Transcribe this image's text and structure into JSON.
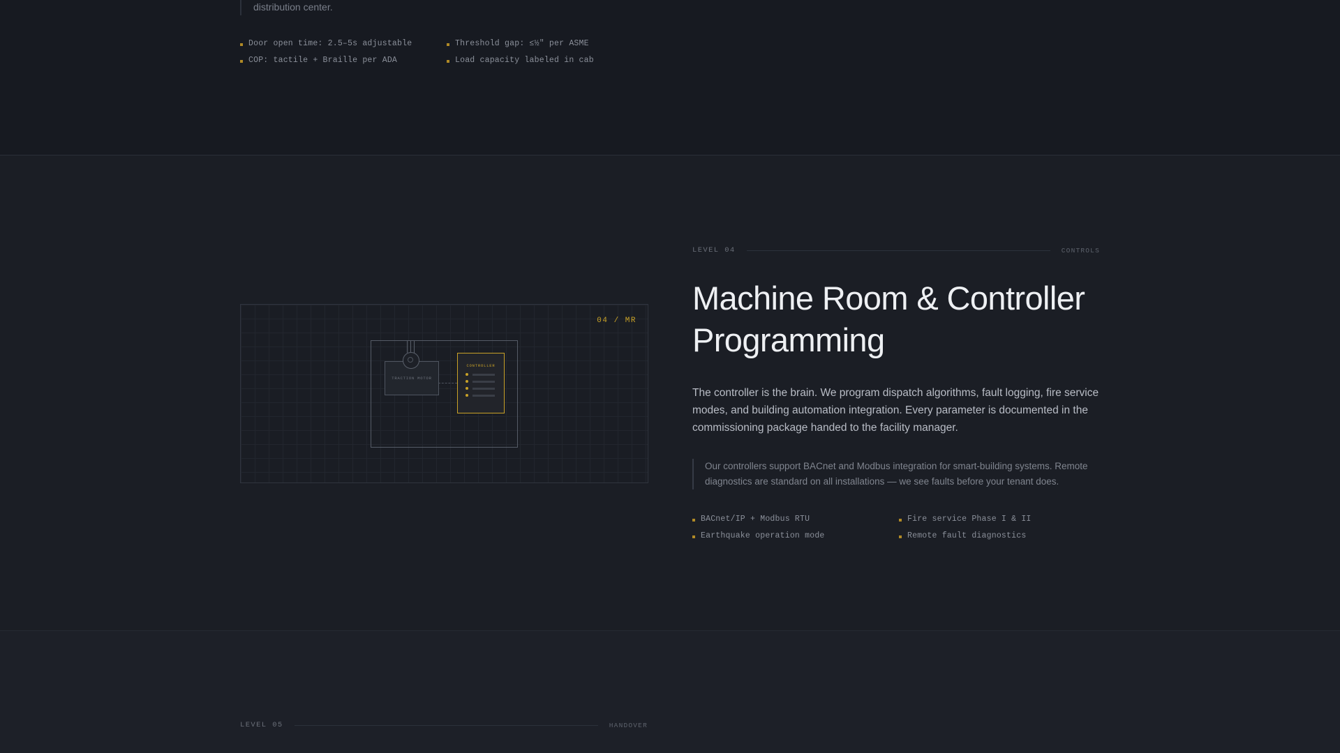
{
  "prev_section": {
    "quote_tail": "distribution center.",
    "features": [
      "Door open time: 2.5–5s adjustable",
      "Threshold gap: ≤½\" per ASME",
      "COP: tactile + Braille per ADA",
      "Load capacity labeled in cab"
    ]
  },
  "section4": {
    "level": "LEVEL 04",
    "tag": "CONTROLS",
    "title": "Machine Room & Controller Programming",
    "lead": "The controller is the brain. We program dispatch algorithms, fault logging, fire service modes, and building automation integration. Every parameter is documented in the commissioning package handed to the facility manager.",
    "quote": "Our controllers support BACnet and Modbus integration for smart-building systems. Remote diagnostics are standard on all installations — we see faults before your tenant does.",
    "features": [
      "BACnet/IP + Modbus RTU",
      "Fire service Phase I & II",
      "Earthquake operation mode",
      "Remote fault diagnostics"
    ],
    "diagram": {
      "code": "04 / MR",
      "motor_label": "TRACTION MOTOR",
      "controller_label": "CONTROLLER",
      "accent": "#c9a227"
    }
  },
  "section5": {
    "level": "LEVEL 05",
    "tag": "HANDOVER"
  },
  "colors": {
    "background": "#181b22",
    "accent": "#c9a227",
    "bullet": "#b08a26",
    "title": "#eef0f3"
  }
}
